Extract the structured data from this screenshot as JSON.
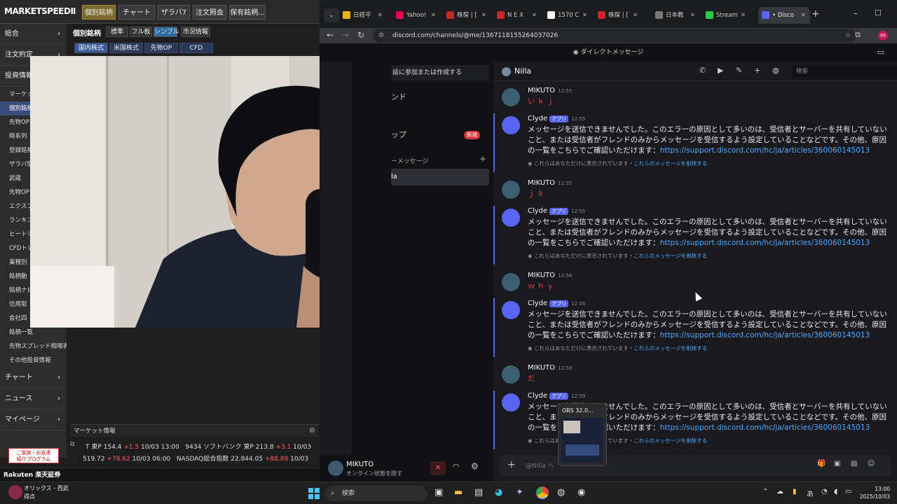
{
  "marketspeed": {
    "logo": "MARKETSPEEDⅡ",
    "toolbar": [
      "個別銘柄",
      "チャート",
      "ザラバ7",
      "注文照会",
      "保有銘柄..."
    ],
    "panel_title": "個別銘柄",
    "view_tabs": [
      "標準",
      "フル板",
      "シンプル"
    ],
    "market_info_button": "市況情報",
    "market_tabs": [
      "国内株式",
      "米国株式",
      "先物OP",
      "CFD"
    ],
    "side_headers": {
      "sougou": "総合",
      "order": "注文約定",
      "invest": "投資情報",
      "chart": "チャート",
      "news": "ニュース",
      "mypage": "マイページ"
    },
    "side_items": [
      "マーケット",
      "個別銘柄",
      "先物OP",
      "時系列",
      "登録銘柄",
      "ザラバ情",
      "武蔵",
      "先物OP",
      "エクスプレ",
      "ランキン",
      "ヒートマ",
      "CFDトレ",
      "業種別",
      "銘柄動",
      "銘柄ナビ",
      "信用取",
      "会社四",
      "銘柄一覧",
      "先物スプレッド相場表",
      "その他投資情報"
    ],
    "market_info_label": "マーケット情報",
    "ticker1": {
      "idx": "T 東P",
      "value": "154.4",
      "change": "+1.5",
      "date": "10/03",
      "time": "13:00",
      "code": "9434",
      "name": "ソフトバンク 東P",
      "price": "213.8",
      "pchange": "+3.1",
      "pdate": "10/03"
    },
    "ticker2": {
      "value": "519.72",
      "change": "+78.62",
      "date": "10/03",
      "time": "06:00",
      "name": "NASDAQ総合指数",
      "price": "22,844.05",
      "pchange": "+88.89",
      "pdate": "10/03"
    },
    "promo": "ご家族・お友達\n紹介プログラム",
    "brand": "Rakuten 楽天証券"
  },
  "browser": {
    "tabs": [
      {
        "label": "日経平",
        "color": "#e8b400"
      },
      {
        "label": "Yahoo!",
        "color": "#e8004a"
      },
      {
        "label": "株探 | [",
        "color": "#c62828"
      },
      {
        "label": "N E X",
        "color": "#c62828"
      },
      {
        "label": "1570 C",
        "color": "#ffffff"
      },
      {
        "label": "株探 | [",
        "color": "#c62828"
      },
      {
        "label": "日本教",
        "color": "#777777"
      },
      {
        "label": "Stream",
        "color": "#2ecc40"
      },
      {
        "label": "• Disco",
        "color": "#5865f2"
      }
    ],
    "url": "discord.com/channels/@me/1367118155264037026"
  },
  "discord": {
    "window_title": "ダイレクトメッセージ",
    "left": {
      "join_button": "話に参加または作成する",
      "friends": "ンド",
      "shop": "ップ",
      "new_badge": "新規",
      "dm_header": "ーメッセージ",
      "dm_selected": "la",
      "user_name": "MIKUTO",
      "user_status": "オンライン状態を隠す"
    },
    "chat": {
      "peer": "Nilla",
      "search_placeholder": "検索",
      "input_placeholder": "@Nilla へ",
      "messages": [
        {
          "author": "MIKUTO",
          "time": "12:55",
          "text": "いｋｊ"
        },
        {
          "author": "Clyde",
          "badge": "アプリ",
          "time": "12:55",
          "text": "メッセージを送信できませんでした。このエラーの原因として多いのは、受信者とサーバーを共有していないこと、または受信者がフレンドのみからメッセージを受信するよう設定していることなどです。その他、原因の一覧をこちらでご確認いただけます：",
          "link": "https://support.discord.com/hc/ja/articles/360060145013",
          "note": "これらはあなただけに表示されています・",
          "note_link": "これらのメッセージを削除する"
        },
        {
          "author": "MIKUTO",
          "time": "12:55",
          "text": "ｊｋ"
        },
        {
          "author": "Clyde",
          "badge": "アプリ",
          "time": "12:55",
          "text": "メッセージを送信できませんでした。このエラーの原因として多いのは、受信者とサーバーを共有していないこと、または受信者がフレンドのみからメッセージを受信するよう設定していることなどです。その他、原因の一覧をこちらでご確認いただけます：",
          "link": "https://support.discord.com/hc/ja/articles/360060145013",
          "note": "これらはあなただけに表示されています・",
          "note_link": "これらのメッセージを削除する"
        },
        {
          "author": "MIKUTO",
          "time": "12:56",
          "text": "ｗｈｙ"
        },
        {
          "author": "Clyde",
          "badge": "アプリ",
          "time": "12:56",
          "text": "メッセージを送信できませんでした。このエラーの原因として多いのは、受信者とサーバーを共有していないこと、または受信者がフレンドのみからメッセージを受信するよう設定していることなどです。その他、原因の一覧をこちらでご確認いただけます：",
          "link": "https://support.discord.com/hc/ja/articles/360060145013",
          "note": "これらはあなただけに表示されています・",
          "note_link": "これらのメッセージを削除する"
        },
        {
          "author": "MIKUTO",
          "time": "12:59",
          "text": "だ"
        },
        {
          "author": "Clyde",
          "badge": "アプリ",
          "time": "12:59",
          "text": "メッセージを送信できませんでした。このエラーの原因として多いのは、受信者とサーバーを共有していないこと、または受信者がフレンドのみからメッセージを受信するよう設定していることなどです。その他、原因の一覧をこちらでご確認いただけます：",
          "link": "https://support.discord.com/hc/ja/articles/360060145013",
          "note": "これらはあなただけに表示されています・",
          "note_link": "これらのメッセージを削除する"
        }
      ]
    },
    "obs_popup": "OBS 32.0..."
  },
  "taskbar": {
    "notice_line1": "オリックス - 西武",
    "notice_line2": "得点",
    "search": "検索",
    "ime": "あ",
    "time": "13:00",
    "date": "2025/10/03"
  }
}
